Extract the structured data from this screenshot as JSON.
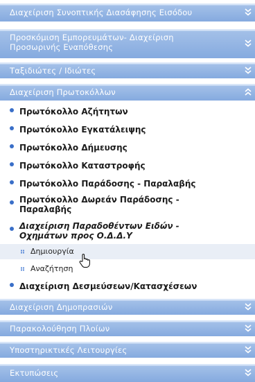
{
  "menu": {
    "top_sections": [
      {
        "label": "Διαχείριση Συνοπτικής Διασάφησης Εισόδου",
        "icon": "chevron-down-icon"
      },
      {
        "label": "Προσκόμιση Εμπορευμάτων- Διαχείριση Προσωρινής Εναπόθεσης",
        "icon": "chevron-down-icon"
      },
      {
        "label": "Ταξιδιώτες / Ιδιώτες",
        "icon": "chevron-down-icon"
      },
      {
        "label": "Διαχείριση Πρωτοκόλλων",
        "icon": "chevron-up-icon"
      }
    ],
    "protocols": [
      {
        "label": "Πρωτόκολλο Αζήτητων"
      },
      {
        "label": "Πρωτόκολλο Εγκατάλειψης"
      },
      {
        "label": "Πρωτόκολλο Δήμευσης"
      },
      {
        "label": "Πρωτόκολλο Καταστροφής"
      },
      {
        "label": "Πρωτόκολλο Παράδοσης - Παραλαβής"
      },
      {
        "label": "Πρωτόκολλο Δωρεάν Παράδοσης - Παραλαβής"
      },
      {
        "label": "Διαχείριση Παραδοθέντων Ειδών - Οχημάτων προς Ο.Δ.Δ.Υ"
      },
      {
        "label": "Διαχείριση Δεσμεύσεων/Κατασχέσεων"
      }
    ],
    "sub_items": [
      {
        "label": "Δημιουργία"
      },
      {
        "label": "Αναζήτηση"
      }
    ],
    "bottom_sections": [
      {
        "label": "Διαχείριση Δημοπρασιών",
        "icon": "chevron-down-icon"
      },
      {
        "label": "Παρακολούθηση Πλοίων",
        "icon": "chevron-down-icon"
      },
      {
        "label": "Υποστηρικτικές Λειτουργίες",
        "icon": "chevron-down-icon"
      },
      {
        "label": "Εκτυπώσεις",
        "icon": "chevron-down-icon"
      }
    ]
  }
}
